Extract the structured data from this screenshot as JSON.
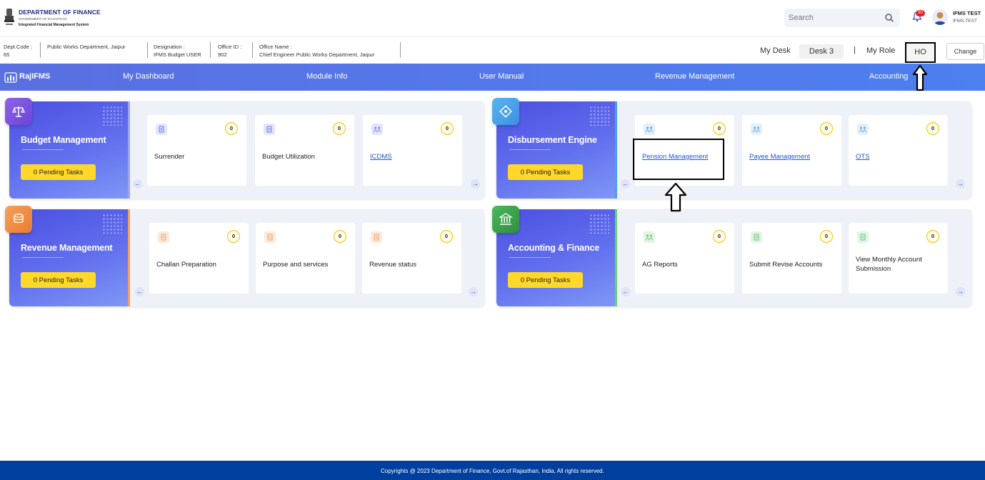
{
  "header": {
    "dept_title": "DEPARTMENT OF FINANCE",
    "govt": "GOVERNMENT OF RAJASTHAN",
    "system": "Integrated Financial Management System",
    "search_placeholder": "Search",
    "notification_count": "50",
    "user_name": "IFMS TEST",
    "user_id": "IFMS.TEST"
  },
  "info_bar": {
    "dept_code_label": "Dept.Code :",
    "dept_code": "65",
    "dept_name": "Public Works Department, Jaipur",
    "designation_label": "Designation :",
    "designation": "IFMS Budget USER",
    "office_id_label": "Office ID :",
    "office_id": "902",
    "office_name_label": "Office Name :",
    "office_name": "Chief Engineer Public Works Department, Jaipur",
    "my_desk_label": "My Desk",
    "desk": "Desk 3",
    "separator": "|",
    "my_role_label": "My Role",
    "role": "HO",
    "change_label": "Change"
  },
  "nav": {
    "brand": "RajIFMS",
    "items": [
      "My Dashboard",
      "Module Info",
      "User Manual",
      "Revenue Management",
      "Accounting"
    ]
  },
  "cards": [
    {
      "title": "Budget Management",
      "pending": "0 Pending Tasks",
      "tiles": [
        {
          "label": "Surrender",
          "count": "0"
        },
        {
          "label": "Budget Utilization",
          "count": "0"
        },
        {
          "label": "ICDMS",
          "count": "0"
        }
      ]
    },
    {
      "title": "Disbursement Engine",
      "pending": "0 Pending Tasks",
      "tiles": [
        {
          "label": "Pension Management",
          "count": "0"
        },
        {
          "label": "Payee Management",
          "count": "0"
        },
        {
          "label": "OTS",
          "count": "0"
        }
      ]
    },
    {
      "title": "Revenue Management",
      "pending": "0 Pending Tasks",
      "tiles": [
        {
          "label": "Challan Preparation",
          "count": "0"
        },
        {
          "label": "Purpose and services",
          "count": "0"
        },
        {
          "label": "Revenue status",
          "count": "0"
        }
      ]
    },
    {
      "title": "Accounting & Finance",
      "pending": "0 Pending Tasks",
      "tiles": [
        {
          "label": "AG Reports",
          "count": "0"
        },
        {
          "label": "Submit Revise Accounts",
          "count": "0"
        },
        {
          "label": "View Monthly Account Submission",
          "count": "0"
        }
      ]
    }
  ],
  "footer": {
    "text": "Copyrights @ 2023 Department of Finance, Govt.of Rajasthan, India, All rights reserved."
  },
  "colors": {
    "nav": "#5478ea",
    "pending": "#ffd829",
    "link": "#1a56db",
    "footer": "#003f9e"
  }
}
